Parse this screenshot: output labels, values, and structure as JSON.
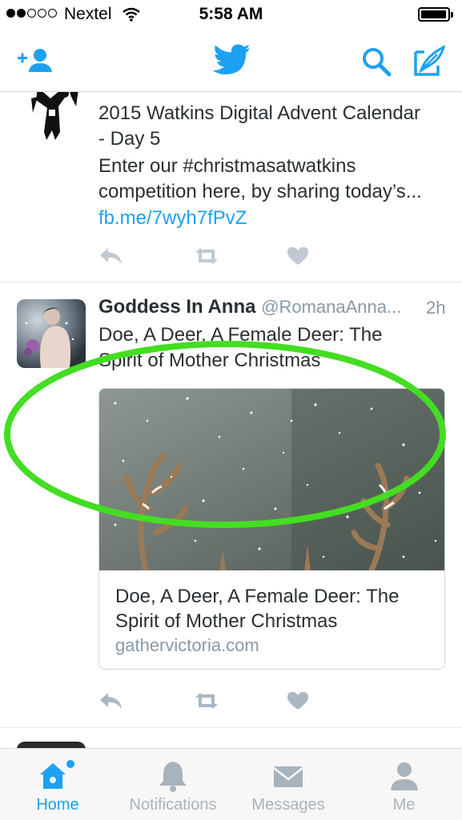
{
  "status_bar": {
    "carrier": "Nextel",
    "time": "5:58 AM"
  },
  "nav": {
    "add_user_icon": "add-user-icon",
    "logo_icon": "twitter-bird-icon",
    "search_icon": "search-icon",
    "compose_icon": "compose-icon"
  },
  "tweets": [
    {
      "text_line1": "2015 Watkins Digital Advent Calendar",
      "text_line2": "- Day 5",
      "text_line3": "Enter our #christmasatwatkins",
      "text_line4": "competition here, by sharing today’s...",
      "link": "fb.me/7wyh7fPvZ"
    },
    {
      "name": "Goddess In Anna",
      "handle": "@RomanaAnna...",
      "time": "2h",
      "text_line1": "Doe, A Deer, A Female Deer: The",
      "text_line2": "Spirit of Mother Christmas",
      "card": {
        "title_line1": "Doe, A Deer, A Female Deer: The",
        "title_line2": "Spirit of Mother Christmas",
        "domain": "gathervictoria.com"
      }
    }
  ],
  "tabs": [
    {
      "label": "Home",
      "active": true
    },
    {
      "label": "Notifications",
      "active": false
    },
    {
      "label": "Messages",
      "active": false
    },
    {
      "label": "Me",
      "active": false
    }
  ],
  "colors": {
    "accent": "#1da1f2",
    "highlight": "#44dd22",
    "muted": "#a8b3bd"
  }
}
